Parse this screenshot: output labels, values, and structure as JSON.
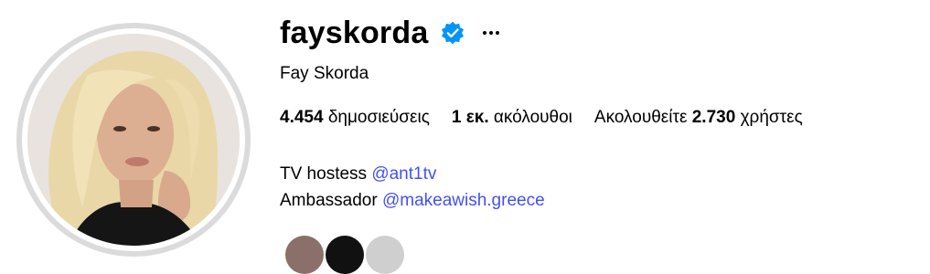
{
  "profile": {
    "username": "fayskorda",
    "full_name": "Fay Skorda",
    "verified_icon": "verified-badge-icon",
    "more_icon": "more-options-icon",
    "accent_color": "#0095f6"
  },
  "stats": {
    "posts_count": "4.454",
    "posts_label": "δημοσιεύσεις",
    "followers_count": "1 εκ.",
    "followers_label": "ακόλουθοι",
    "following_prefix": "Ακολουθείτε",
    "following_count": "2.730",
    "following_suffix": "χρήστες"
  },
  "bio": {
    "line1_text": "TV hostess",
    "line1_mention": "@ant1tv",
    "line2_text": "Ambassador",
    "line2_mention": "@makeawish.greece",
    "mention_color": "#4150f7"
  }
}
